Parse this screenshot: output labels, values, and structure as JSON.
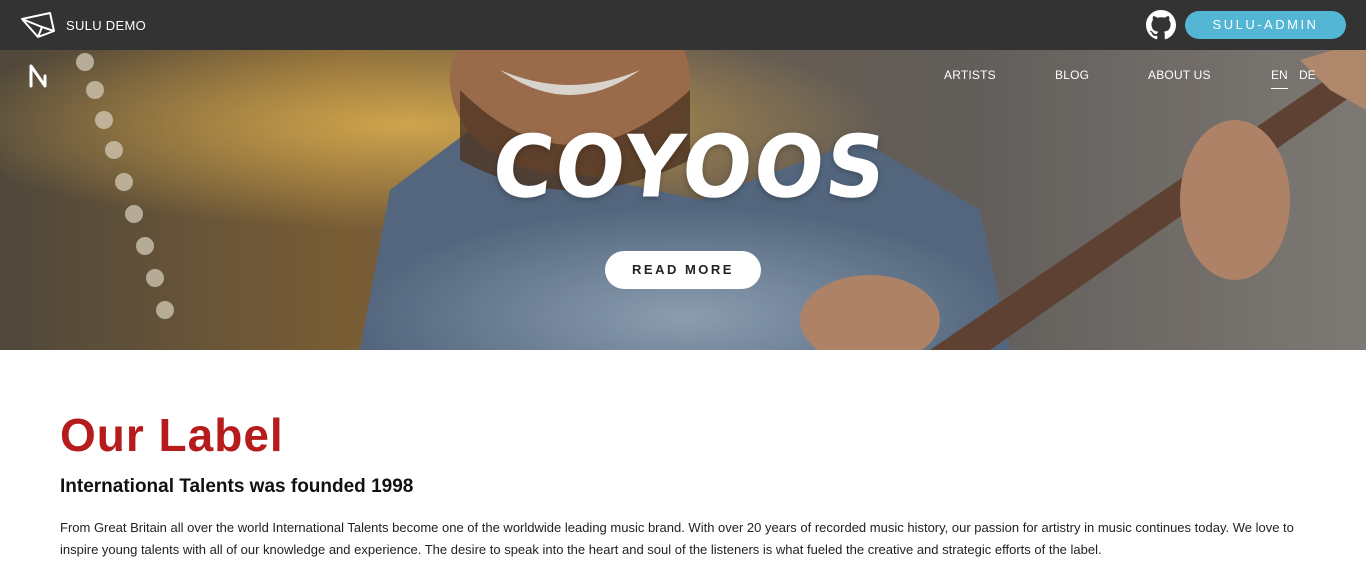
{
  "topbar": {
    "demo_title": "SULU DEMO",
    "admin_label": "SULU-ADMIN",
    "icons": {
      "logo": "paper-plane-icon",
      "github": "github-icon"
    },
    "colors": {
      "background": "#333333",
      "admin_button": "#52b6d4"
    }
  },
  "nav": {
    "items": [
      {
        "label": "ARTISTS"
      },
      {
        "label": "BLOG"
      },
      {
        "label": "ABOUT US"
      }
    ],
    "languages": {
      "active": "EN",
      "other": "DE"
    }
  },
  "hero": {
    "title": "COYOOS",
    "cta_label": "READ MORE"
  },
  "content": {
    "heading": "Our Label",
    "subheading": "International Talents was founded 1998",
    "body": "From Great Britain all over the world International Talents become one of the worldwide leading music brand. With over 20 years of recorded music history, our passion for artistry in music continues today. We love to inspire young talents with all of our knowledge and experience. The desire to speak into the heart and soul of the listeners is what fueled the creative and strategic efforts of the label.",
    "colors": {
      "heading": "#b71c1c"
    }
  }
}
